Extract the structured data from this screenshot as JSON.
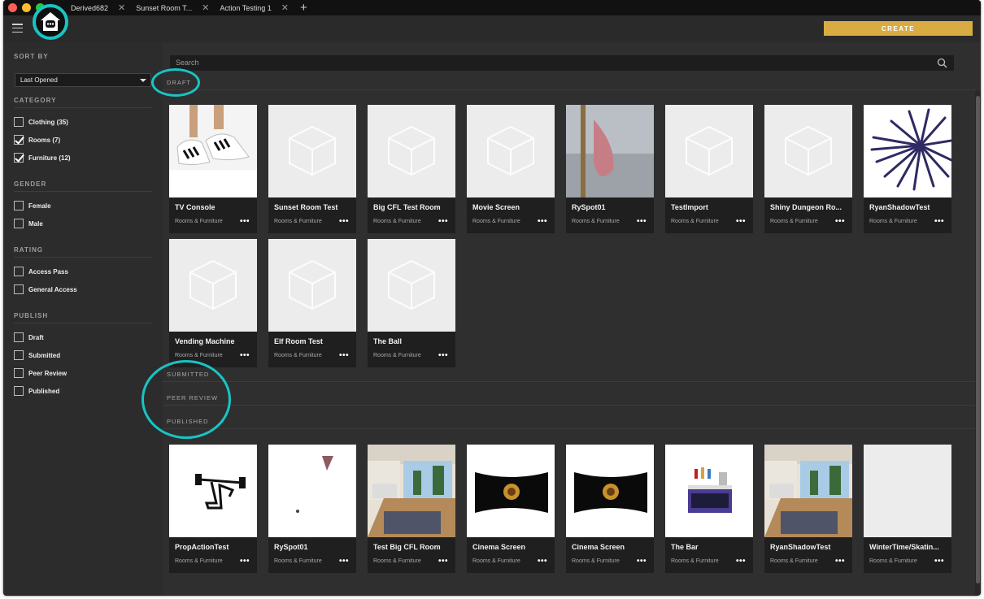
{
  "tabs": [
    {
      "label": "Derived682"
    },
    {
      "label": "Sunset Room T..."
    },
    {
      "label": "Action Testing 1"
    }
  ],
  "header": {
    "create_label": "CREATE"
  },
  "sidebar": {
    "sort_heading": "SORT BY",
    "sort_value": "Last Opened",
    "category_heading": "CATEGORY",
    "category": [
      {
        "label": "Clothing (35)",
        "checked": false
      },
      {
        "label": "Rooms (7)",
        "checked": true
      },
      {
        "label": "Furniture (12)",
        "checked": true
      }
    ],
    "gender_heading": "GENDER",
    "gender": [
      {
        "label": "Female",
        "checked": false
      },
      {
        "label": "Male",
        "checked": false
      }
    ],
    "rating_heading": "RATING",
    "rating": [
      {
        "label": "Access Pass",
        "checked": false
      },
      {
        "label": "General Access",
        "checked": false
      }
    ],
    "publish_heading": "PUBLISH",
    "publish": [
      {
        "label": "Draft",
        "checked": false
      },
      {
        "label": "Submitted",
        "checked": false
      },
      {
        "label": "Peer Review",
        "checked": false
      },
      {
        "label": "Published",
        "checked": false
      }
    ]
  },
  "main": {
    "search_placeholder": "Search",
    "sections": {
      "draft": "DRAFT",
      "submitted": "SUBMITTED",
      "peer_review": "PEER REVIEW",
      "published": "PUBLISHED"
    },
    "draft_items": [
      {
        "title": "TV Console",
        "category": "Rooms & Furniture",
        "thumb": "sneakers"
      },
      {
        "title": "Sunset Room Test",
        "category": "Rooms & Furniture",
        "thumb": "placeholder-cube"
      },
      {
        "title": "Big CFL Test Room",
        "category": "Rooms & Furniture",
        "thumb": "placeholder-cube"
      },
      {
        "title": "Movie Screen",
        "category": "Rooms & Furniture",
        "thumb": "placeholder-cube"
      },
      {
        "title": "RySpot01",
        "category": "Rooms & Furniture",
        "thumb": "spot-closeup"
      },
      {
        "title": "TestImport",
        "category": "Rooms & Furniture",
        "thumb": "placeholder-cube"
      },
      {
        "title": "Shiny Dungeon Ro...",
        "category": "Rooms & Furniture",
        "thumb": "placeholder-cube"
      },
      {
        "title": "RyanShadowTest",
        "category": "Rooms & Furniture",
        "thumb": "purple-rays"
      },
      {
        "title": "Vending Machine",
        "category": "Rooms & Furniture",
        "thumb": "placeholder-cube"
      },
      {
        "title": "Elf Room Test",
        "category": "Rooms & Furniture",
        "thumb": "placeholder-cube"
      },
      {
        "title": "The Ball",
        "category": "Rooms & Furniture",
        "thumb": "placeholder-cube"
      }
    ],
    "published_items": [
      {
        "title": "PropActionTest",
        "category": "Rooms & Furniture",
        "thumb": "barbell"
      },
      {
        "title": "RySpot01",
        "category": "Rooms & Furniture",
        "thumb": "spot-small"
      },
      {
        "title": "Test Big CFL Room",
        "category": "Rooms & Furniture",
        "thumb": "room"
      },
      {
        "title": "Cinema Screen",
        "category": "Rooms & Furniture",
        "thumb": "cinema"
      },
      {
        "title": "Cinema Screen",
        "category": "Rooms & Furniture",
        "thumb": "cinema"
      },
      {
        "title": "The Bar",
        "category": "Rooms & Furniture",
        "thumb": "bar"
      },
      {
        "title": "RyanShadowTest",
        "category": "Rooms & Furniture",
        "thumb": "room"
      },
      {
        "title": "WinterTime/Skatin...",
        "category": "Rooms & Furniture",
        "thumb": "blank"
      }
    ],
    "more_glyph": "•••"
  },
  "colors": {
    "accent": "#d9ac43",
    "annotation": "#19c4c4",
    "background": "#2f2f2f"
  }
}
